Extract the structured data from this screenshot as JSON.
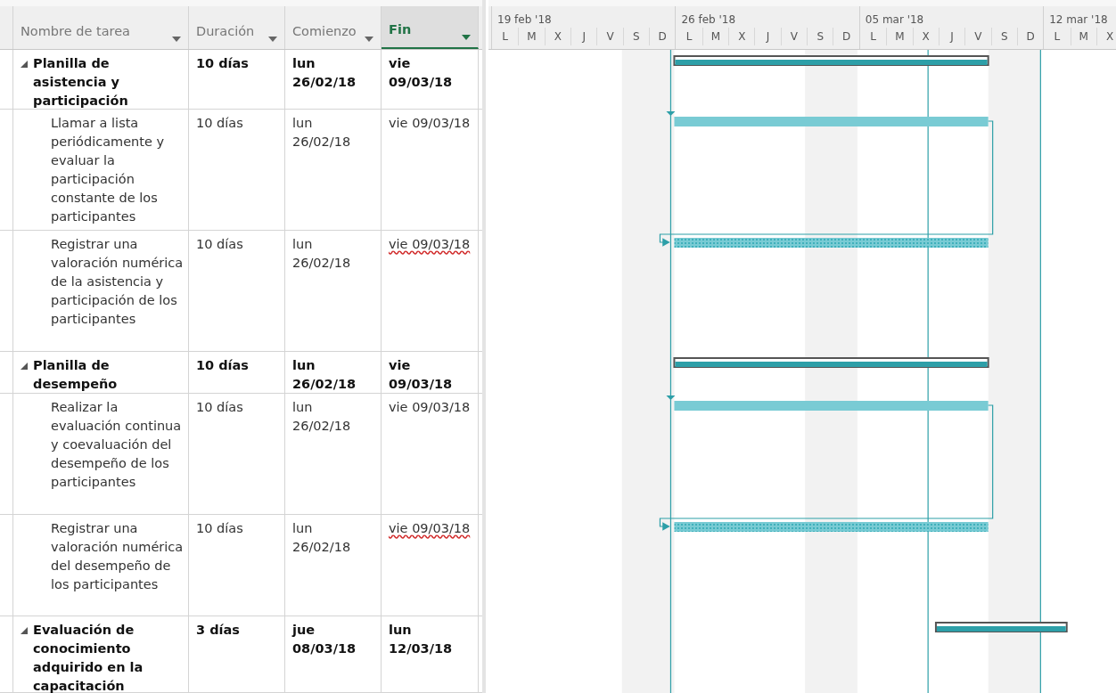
{
  "columns": [
    {
      "label": "Nombre de tarea",
      "selected": false
    },
    {
      "label": "Duración",
      "selected": false
    },
    {
      "label": "Comienzo",
      "selected": false
    },
    {
      "label": "Fin",
      "selected": true
    }
  ],
  "timeline": {
    "weeks": [
      {
        "label": "19 feb '18",
        "days": [
          "L",
          "M",
          "X",
          "J",
          "V",
          "S",
          "D"
        ]
      },
      {
        "label": "26 feb '18",
        "days": [
          "L",
          "M",
          "X",
          "J",
          "V",
          "S",
          "D"
        ]
      },
      {
        "label": "05 mar '18",
        "days": [
          "L",
          "M",
          "X",
          "J",
          "V",
          "S",
          "D"
        ]
      },
      {
        "label": "12 mar '18",
        "days": [
          "L",
          "M",
          "X"
        ]
      }
    ]
  },
  "tasks": [
    {
      "name": "Planilla de asistencia y participación",
      "duration": "10 días",
      "start": "lun 26/02/18",
      "finish": "vie 09/03/18",
      "kind": "summary",
      "expanded": true,
      "misspelled": false,
      "children": [
        {
          "name": "Llamar a lista periódicamente y evaluar la participación constante de los participantes",
          "duration": "10 días",
          "start": "lun 26/02/18",
          "finish": "vie 09/03/18",
          "kind": "task",
          "misspelled": false
        },
        {
          "name": "Registrar una valoración numérica de la asistencia y participación de los participantes",
          "duration": "10 días",
          "start": "lun 26/02/18",
          "finish": "vie 09/03/18",
          "kind": "manual",
          "misspelled": true
        }
      ]
    },
    {
      "name": "Planilla de desempeño",
      "duration": "10 días",
      "start": "lun 26/02/18",
      "finish": "vie 09/03/18",
      "kind": "summary",
      "expanded": true,
      "misspelled": false,
      "children": [
        {
          "name": "Realizar la evaluación continua y coevaluación del desempeño de los participantes",
          "duration": "10 días",
          "start": "lun 26/02/18",
          "finish": "vie 09/03/18",
          "kind": "task",
          "misspelled": false
        },
        {
          "name": "Registrar una valoración numérica del desempeño de los participantes",
          "duration": "10 días",
          "start": "lun 26/02/18",
          "finish": "vie 09/03/18",
          "kind": "manual",
          "misspelled": true
        }
      ]
    },
    {
      "name": "Evaluación de conocimiento adquirido en la capacitación",
      "duration": "3 días",
      "start": "jue 08/03/18",
      "finish": "lun 12/03/18",
      "kind": "summary",
      "expanded": true,
      "misspelled": false
    }
  ]
}
